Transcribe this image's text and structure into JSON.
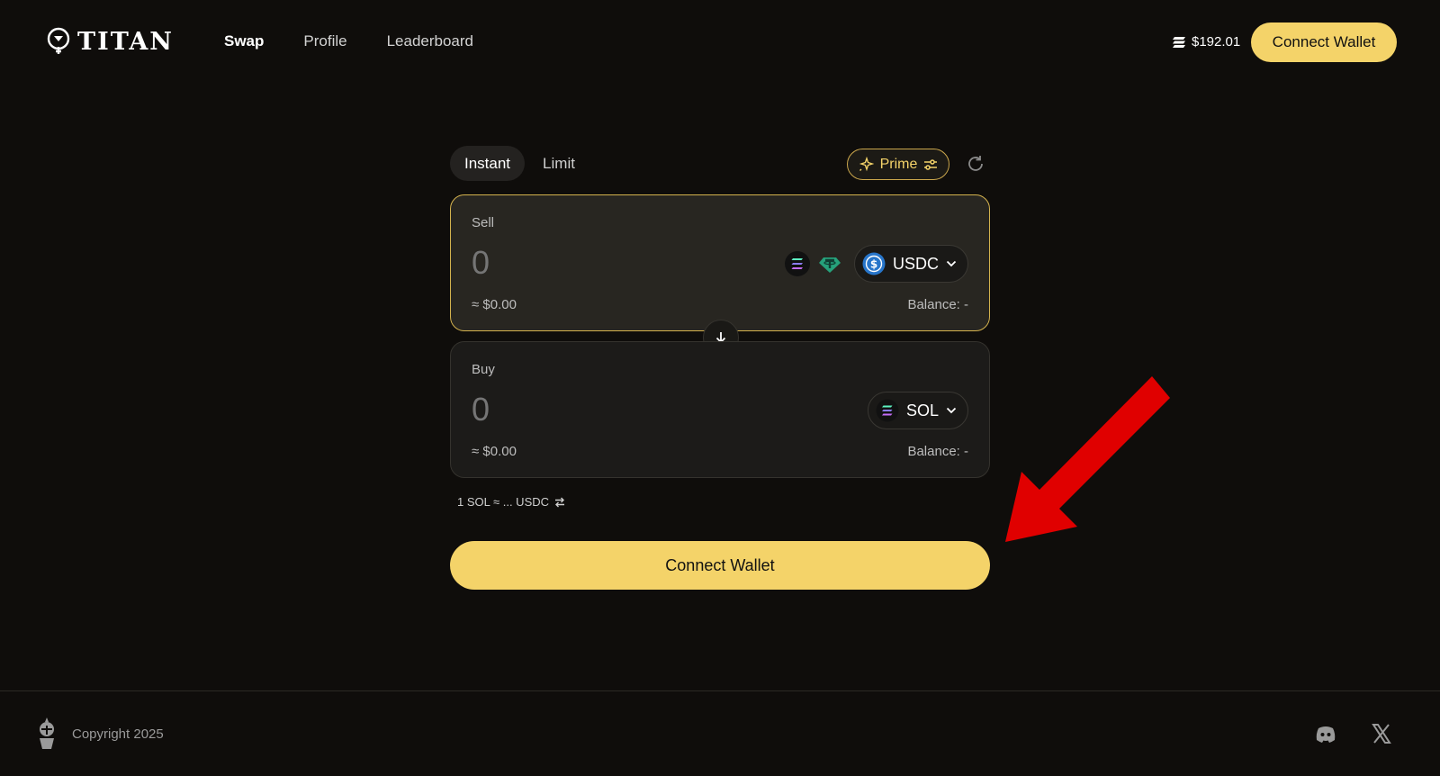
{
  "brand": {
    "name": "TITAN"
  },
  "nav": {
    "items": [
      {
        "label": "Swap",
        "active": true
      },
      {
        "label": "Profile",
        "active": false
      },
      {
        "label": "Leaderboard",
        "active": false
      }
    ]
  },
  "header": {
    "sol_price": "$192.01",
    "connect_label": "Connect Wallet"
  },
  "swap": {
    "tabs": [
      {
        "label": "Instant",
        "active": true
      },
      {
        "label": "Limit",
        "active": false
      }
    ],
    "prime_label": "Prime",
    "sell": {
      "label": "Sell",
      "amount_placeholder": "0",
      "usd_value": "≈ $0.00",
      "balance": "Balance: -",
      "token": "USDC",
      "quick_tokens": [
        "sol-token-icon",
        "usdt-token-icon"
      ]
    },
    "buy": {
      "label": "Buy",
      "amount_placeholder": "0",
      "usd_value": "≈ $0.00",
      "balance": "Balance: -",
      "token": "SOL"
    },
    "rate": "1 SOL ≈ ... USDC",
    "connect_label": "Connect Wallet"
  },
  "footer": {
    "copyright": "Copyright 2025",
    "socials": [
      "discord-icon",
      "x-icon"
    ]
  },
  "colors": {
    "background": "#0f0d0b",
    "accent": "#f4d369",
    "card": "#1c1b19",
    "annotation": "#e00000"
  }
}
